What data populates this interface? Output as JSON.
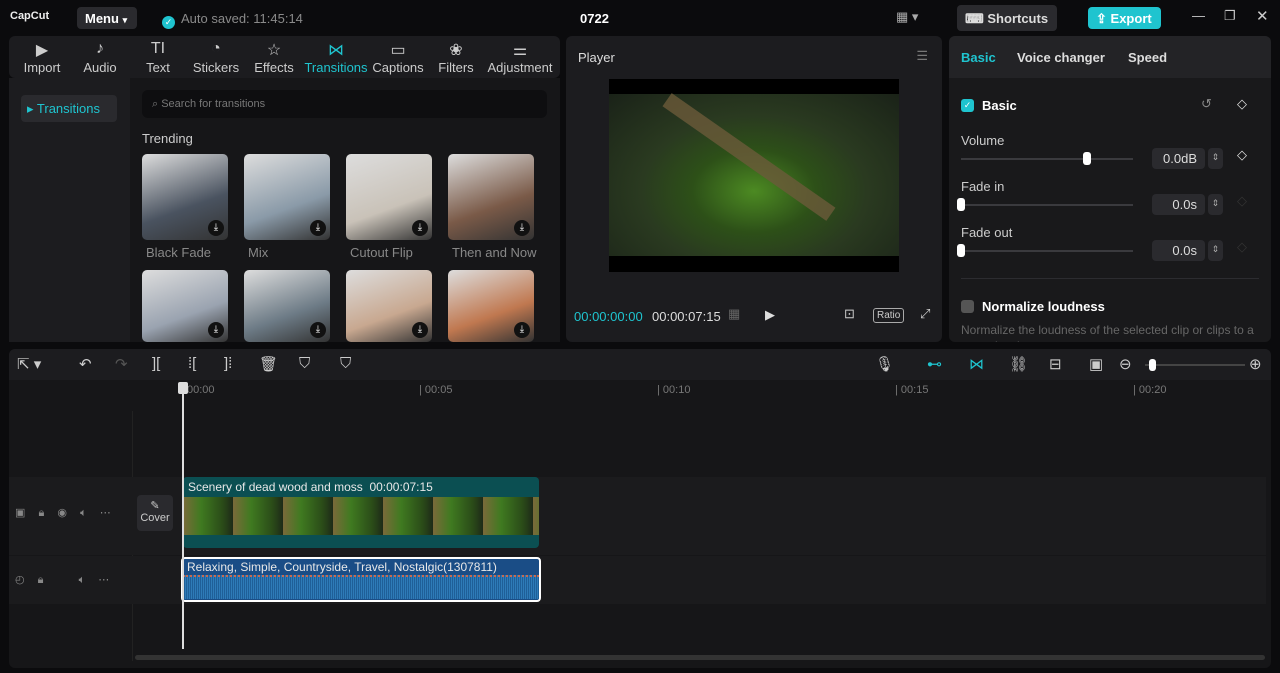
{
  "app": {
    "logo": "CapCut",
    "menu": "Menu",
    "autosave": "Auto saved: 11:45:14",
    "project": "0722",
    "shortcuts": "Shortcuts",
    "export": "Export"
  },
  "toolbar": [
    {
      "icon": "import-icon",
      "glyph": "▶",
      "label": "Import"
    },
    {
      "icon": "audio-icon",
      "glyph": "♪",
      "label": "Audio"
    },
    {
      "icon": "text-icon",
      "glyph": "TI",
      "label": "Text"
    },
    {
      "icon": "stickers-icon",
      "glyph": "◔",
      "label": "Stickers"
    },
    {
      "icon": "effects-icon",
      "glyph": "☆",
      "label": "Effects"
    },
    {
      "icon": "transitions-icon",
      "glyph": "⋈",
      "label": "Transitions"
    },
    {
      "icon": "captions-icon",
      "glyph": "▭",
      "label": "Captions"
    },
    {
      "icon": "filters-icon",
      "glyph": "❀",
      "label": "Filters"
    },
    {
      "icon": "adjustment-icon",
      "glyph": "⚌",
      "label": "Adjustment"
    }
  ],
  "sidebar": {
    "item": "Transitions"
  },
  "search": {
    "placeholder": "Search for transitions"
  },
  "section": "Trending",
  "transitions": [
    {
      "label": "Black Fade",
      "color": "#4a5360"
    },
    {
      "label": "Mix",
      "color": "#8a9aa8"
    },
    {
      "label": "Cutout Flip",
      "color": "#c9c2b8"
    },
    {
      "label": "Then and Now",
      "color": "#7a5a48"
    },
    {
      "label": "",
      "color": "#9aa3b0"
    },
    {
      "label": "",
      "color": "#6d7b86"
    },
    {
      "label": "",
      "color": "#c8a890"
    },
    {
      "label": "",
      "color": "#c07850"
    }
  ],
  "player": {
    "title": "Player",
    "current": "00:00:00:00",
    "duration": "00:00:07:15",
    "ratio": "Ratio"
  },
  "right": {
    "tabs": [
      "Basic",
      "Voice changer",
      "Speed"
    ],
    "section": "Basic",
    "volume_label": "Volume",
    "volume": "0.0dB",
    "volume_level": 0.73,
    "fadein_label": "Fade in",
    "fadein": "0.0s",
    "fadeout_label": "Fade out",
    "fadeout": "0.0s",
    "normalize": "Normalize loudness",
    "normalize_desc": "Normalize the loudness of the selected clip or clips to a target level"
  },
  "timeline": {
    "ticks": [
      "00:00",
      "| 00:05",
      "| 00:10",
      "| 00:15",
      "| 00:20"
    ],
    "cover": "Cover",
    "video_clip": {
      "name": "Scenery of dead wood and moss",
      "duration": "00:00:07:15"
    },
    "audio_clip": {
      "name": "Relaxing, Simple, Countryside, Travel, Nostalgic(1307811)"
    }
  }
}
